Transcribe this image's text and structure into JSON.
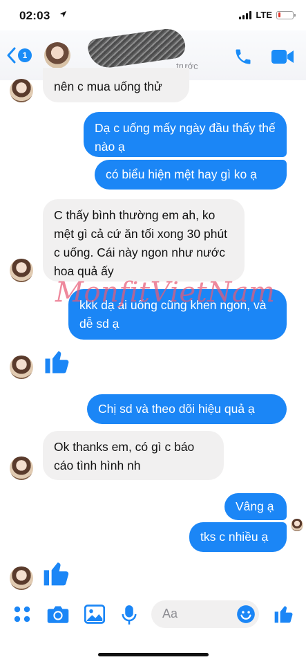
{
  "status": {
    "time": "02:03",
    "network": "LTE",
    "battery_level": 0.15
  },
  "header": {
    "unread_count": "1",
    "subtitle": "trước"
  },
  "messages": [
    {
      "from": "them",
      "text": "nên c mua uống thử"
    },
    {
      "from": "me",
      "text": "Dạ c uống mấy ngày đầu thấy thế nào ạ"
    },
    {
      "from": "me",
      "text": "có biểu hiện mệt hay gì ko ạ"
    },
    {
      "from": "them",
      "text": "C thấy bình thường em ah, ko mệt gì cả cứ ăn tối xong 30 phút c uống. Cái này ngon như nước hoa quả ấy"
    },
    {
      "from": "me",
      "text": "kkk dạ ai uống cũng khen ngon, và dễ sd ạ"
    },
    {
      "from": "them",
      "type": "like"
    },
    {
      "from": "me",
      "text": "Chị sd và theo dõi hiệu quả ạ"
    },
    {
      "from": "them",
      "text": "Ok thanks em, có gì c báo cáo tình hình nh"
    },
    {
      "from": "me",
      "text": "Vâng ạ"
    },
    {
      "from": "me",
      "text": "tks c nhiều ạ"
    },
    {
      "from": "them",
      "type": "like"
    }
  ],
  "watermark": "MonfitVietNam",
  "composer": {
    "placeholder": "Aa"
  },
  "colors": {
    "accent": "#1b86f6",
    "incoming_bubble": "#f1f0f0",
    "watermark": "#e85a76"
  }
}
